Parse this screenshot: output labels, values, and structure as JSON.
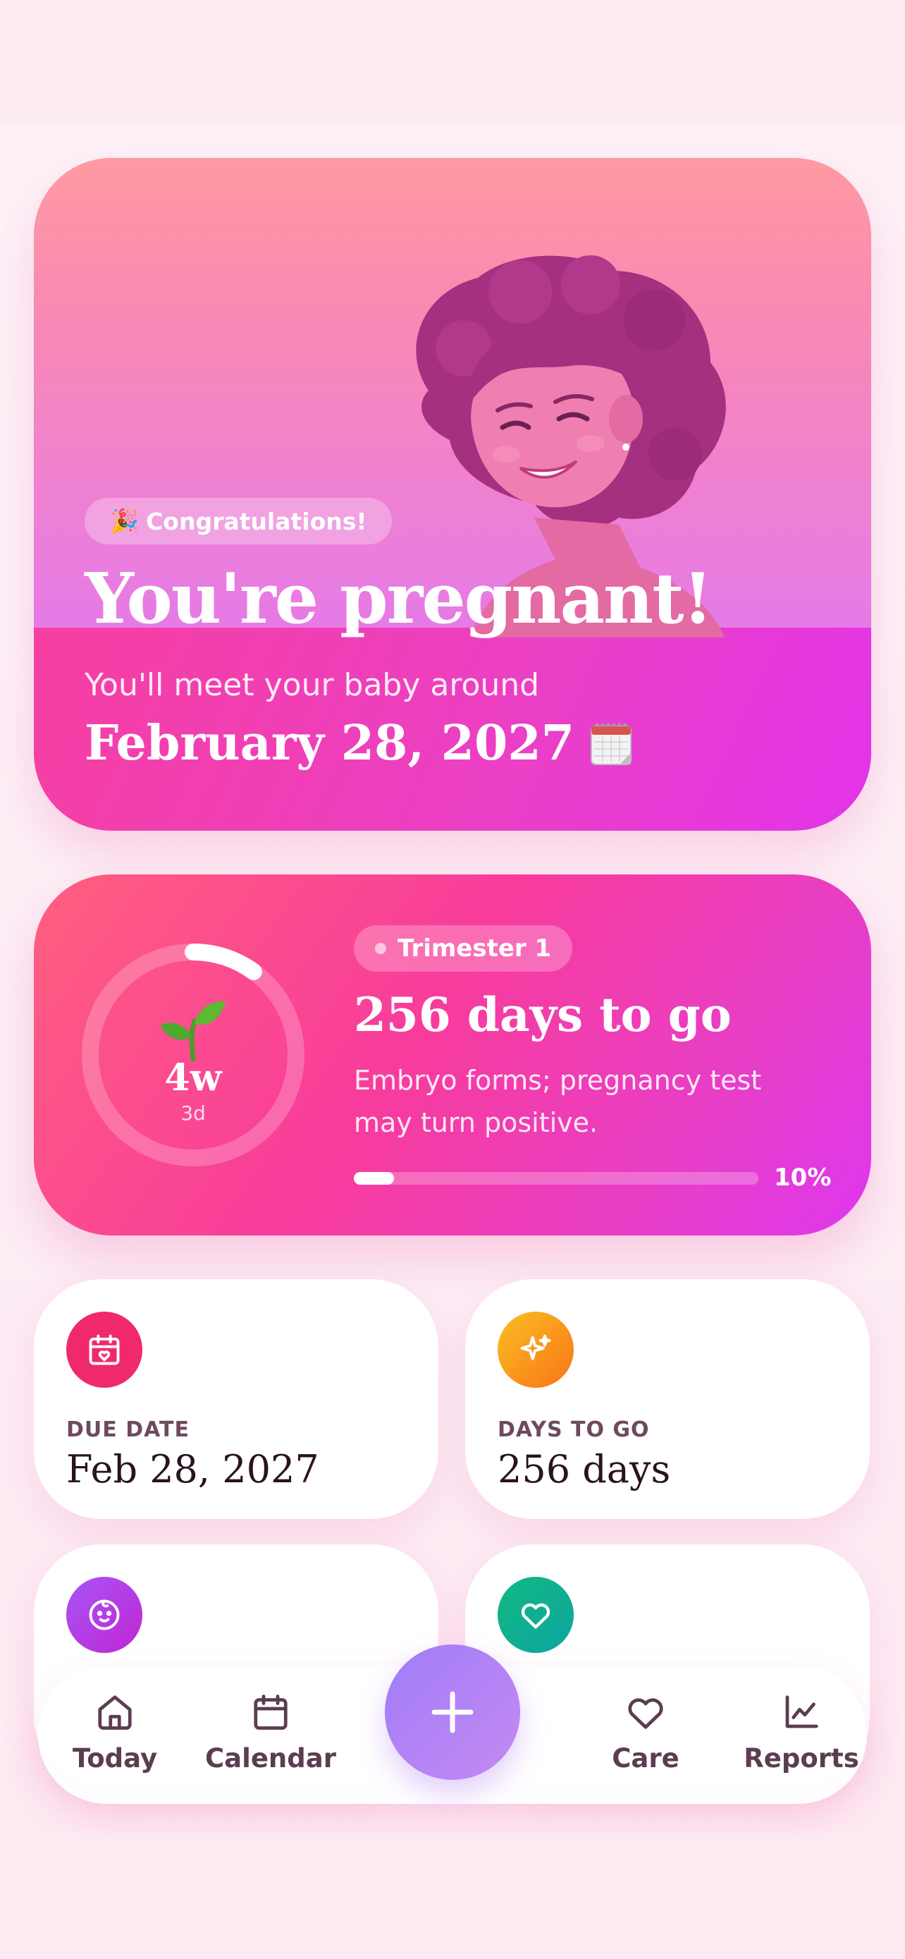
{
  "hero": {
    "badge_emoji": "🎉",
    "badge_label": "Congratulations!",
    "title": "You're pregnant!",
    "subtitle": "You'll meet your baby around",
    "due_date": "February 28, 2027"
  },
  "progress": {
    "weeks": "4w",
    "days": "3d",
    "trimester": "Trimester 1",
    "days_to_go_title": "256 days to go",
    "description": "Embryo forms; pregnancy test may turn positive.",
    "percent_label": "10%",
    "percent_value": 10,
    "ring_fraction": 0.1
  },
  "stats": [
    {
      "label": "DUE DATE",
      "value": "Feb 28, 2027",
      "icon": "calendar-heart-icon",
      "color": "#f0296e"
    },
    {
      "label": "DAYS TO GO",
      "value": "256 days",
      "icon": "sparkles-icon",
      "color": "#fb8c0a"
    },
    {
      "label": "",
      "value": "",
      "icon": "baby-icon",
      "color": "#a855f7"
    },
    {
      "label": "",
      "value": "",
      "icon": "heart-icon",
      "color": "#10b981"
    }
  ],
  "nav": {
    "today": "Today",
    "calendar": "Calendar",
    "care": "Care",
    "reports": "Reports"
  }
}
